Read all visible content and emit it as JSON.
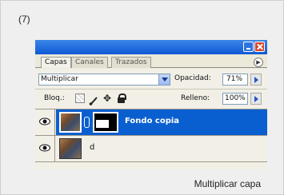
{
  "figure": {
    "number": "(7)",
    "caption": "Multiplicar capa"
  },
  "panel": {
    "tabs": [
      {
        "label": "Capas"
      },
      {
        "label": "Canales"
      },
      {
        "label": "Trazados"
      }
    ],
    "blend_mode": "Multiplicar",
    "opacity_label": "Opacidad:",
    "opacity_value": "71%",
    "lock_label": "Bloq.:",
    "fill_label": "Relleno:",
    "fill_value": "100%",
    "layers": [
      {
        "name": "Fondo copia",
        "selected": true,
        "visible": true,
        "has_mask": true
      },
      {
        "name": "d",
        "selected": false,
        "visible": true,
        "has_mask": false
      }
    ]
  },
  "colors": {
    "titlebar": "#0f58d6",
    "selected_row": "#0a5fd0",
    "panel_bg": "#ece9d8"
  }
}
